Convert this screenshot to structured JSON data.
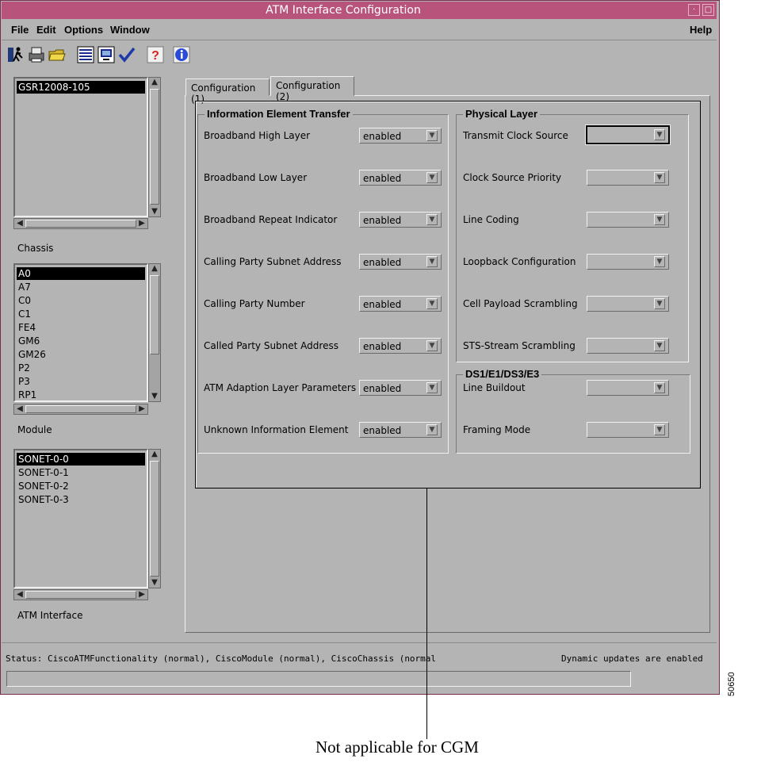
{
  "window": {
    "title": "ATM Interface Configuration"
  },
  "menubar": {
    "file": "File",
    "edit": "Edit",
    "options": "Options",
    "window": "Window",
    "help": "Help"
  },
  "toolbar": {
    "icons": [
      "exit-icon",
      "print-icon",
      "open-folder-icon",
      "list-icon",
      "monitor-icon",
      "checkmark-icon",
      "help-question-icon",
      "info-icon"
    ]
  },
  "chassis_list": {
    "items": [
      "GSR12008-105"
    ],
    "selected": 0,
    "label": "Chassis"
  },
  "module_list": {
    "items": [
      "A0",
      "A7",
      "C0",
      "C1",
      "FE4",
      "GM6",
      "GM26",
      "P2",
      "P3",
      "RP1"
    ],
    "selected": 0,
    "label": "Module"
  },
  "interface_list": {
    "items": [
      "SONET-0-0",
      "SONET-0-1",
      "SONET-0-2",
      "SONET-0-3"
    ],
    "selected": 0,
    "label": "ATM Interface"
  },
  "tabs": [
    {
      "label": "Configuration (1)",
      "active": false
    },
    {
      "label": "Configuration (2)",
      "active": true
    }
  ],
  "ie_transfer": {
    "title": "Information Element Transfer",
    "fields": [
      {
        "label": "Broadband High Layer",
        "value": "enabled"
      },
      {
        "label": "Broadband Low Layer",
        "value": "enabled"
      },
      {
        "label": "Broadband Repeat Indicator",
        "value": "enabled"
      },
      {
        "label": "Calling Party Subnet Address",
        "value": "enabled"
      },
      {
        "label": "Calling Party Number",
        "value": "enabled"
      },
      {
        "label": "Called Party Subnet Address",
        "value": "enabled"
      },
      {
        "label": "ATM Adaption Layer Parameters",
        "value": "enabled"
      },
      {
        "label": "Unknown Information Element",
        "value": "enabled"
      }
    ]
  },
  "physical_layer": {
    "title": "Physical Layer",
    "fields": [
      {
        "label": "Transmit Clock Source",
        "value": ""
      },
      {
        "label": "Clock Source Priority",
        "value": ""
      },
      {
        "label": "Line Coding",
        "value": ""
      },
      {
        "label": "Loopback Configuration",
        "value": ""
      },
      {
        "label": "Cell Payload Scrambling",
        "value": ""
      },
      {
        "label": "STS-Stream Scrambling",
        "value": ""
      }
    ]
  },
  "ds_group": {
    "title": "DS1/E1/DS3/E3",
    "fields": [
      {
        "label": "Line Buildout",
        "value": ""
      },
      {
        "label": "Framing Mode",
        "value": ""
      }
    ]
  },
  "status": {
    "text": "Status: CiscoATMFunctionality (normal), CiscoModule (normal), CiscoChassis (normal",
    "updates": "Dynamic updates are enabled",
    "field_value": ""
  },
  "callout": {
    "text": "Not applicable for CGM"
  },
  "figure_id": "50650",
  "colors": {
    "titlebar": "#b8547c",
    "background": "#b4b4b4",
    "selection": "#000000"
  }
}
